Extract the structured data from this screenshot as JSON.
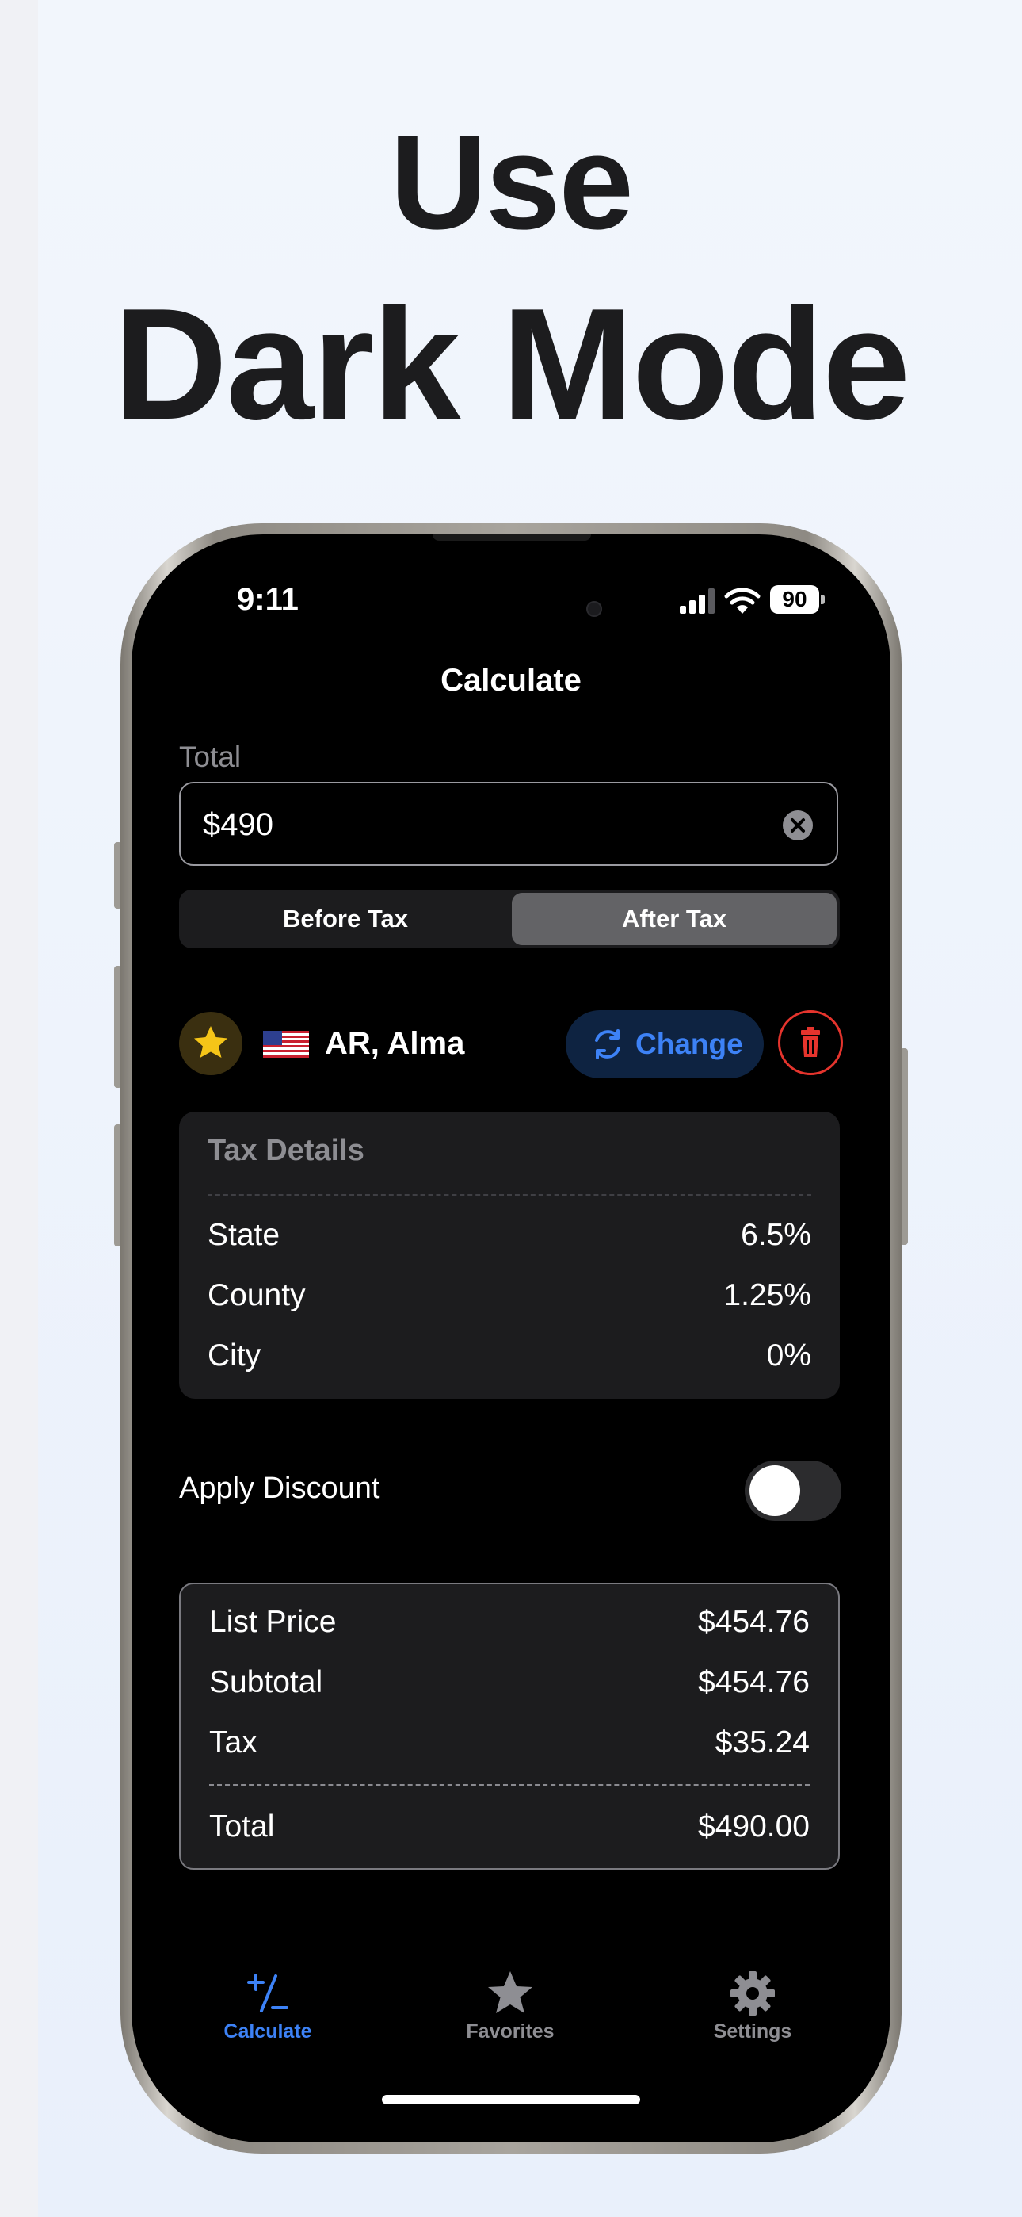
{
  "headline": {
    "line1": "Use",
    "line2": "Dark Mode"
  },
  "status_bar": {
    "time": "9:11",
    "battery": "90"
  },
  "nav": {
    "title": "Calculate"
  },
  "total_input": {
    "label": "Total",
    "value": "$490"
  },
  "tax_mode": {
    "options": [
      "Before Tax",
      "After Tax"
    ],
    "selected": "After Tax"
  },
  "location": {
    "name": "AR, Alma",
    "change_label": "Change",
    "favorite": true
  },
  "tax_details": {
    "title": "Tax Details",
    "rows": [
      {
        "label": "State",
        "value": "6.5%"
      },
      {
        "label": "County",
        "value": "1.25%"
      },
      {
        "label": "City",
        "value": "0%"
      }
    ]
  },
  "discount": {
    "label": "Apply Discount",
    "enabled": false
  },
  "summary": {
    "rows": [
      {
        "label": "List Price",
        "value": "$454.76"
      },
      {
        "label": "Subtotal",
        "value": "$454.76"
      },
      {
        "label": "Tax",
        "value": "$35.24"
      }
    ],
    "total": {
      "label": "Total",
      "value": "$490.00"
    }
  },
  "tabs": [
    {
      "label": "Calculate",
      "icon": "plus-minus-icon",
      "active": true
    },
    {
      "label": "Favorites",
      "icon": "star-icon",
      "active": false
    },
    {
      "label": "Settings",
      "icon": "gear-icon",
      "active": false
    }
  ],
  "colors": {
    "accent": "#3d82f6",
    "danger": "#e5342d",
    "star": "#f5c518",
    "background": "#000000",
    "card": "#1c1c1e"
  }
}
